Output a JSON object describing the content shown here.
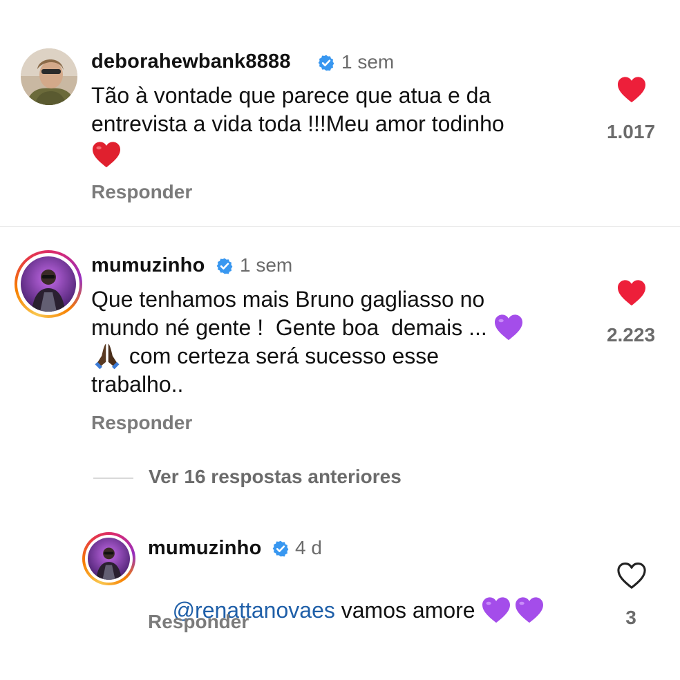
{
  "comments": [
    {
      "username": "deborahewbank8888",
      "time": "1 sem",
      "text_lines": [
        "Tão à vontade que parece que atua e da",
        "entrevista a vida toda !!!Meu amor todinho"
      ],
      "reply_label": "Responder",
      "likes": "1.017",
      "liked": true
    },
    {
      "username": "mumuzinho",
      "time": "1 sem",
      "text_lines": [
        "Que tenhamos mais Bruno gagliasso no",
        "mundo né gente !  Gente boa  demais ...",
        " com certeza será sucesso esse",
        "trabalho.."
      ],
      "reply_label": "Responder",
      "likes": "2.223",
      "liked": true
    }
  ],
  "replies_toggle": "Ver 16 respostas anteriores",
  "reply": {
    "username": "mumuzinho",
    "time": "4 d",
    "mention": "@renattanovaes",
    "text": " vamos amore ",
    "reply_label": "Responder",
    "likes": "3",
    "liked": false
  },
  "colors": {
    "heart_red": "#ed1f3a",
    "verified_blue": "#3897f0",
    "purple_heart": "#a44dea",
    "mention_blue": "#1f5fa8"
  },
  "icons": [
    "verified-icon",
    "heart-filled-icon",
    "heart-outline-icon",
    "red-heart-emoji",
    "purple-heart-emoji",
    "praying-hands-emoji"
  ]
}
